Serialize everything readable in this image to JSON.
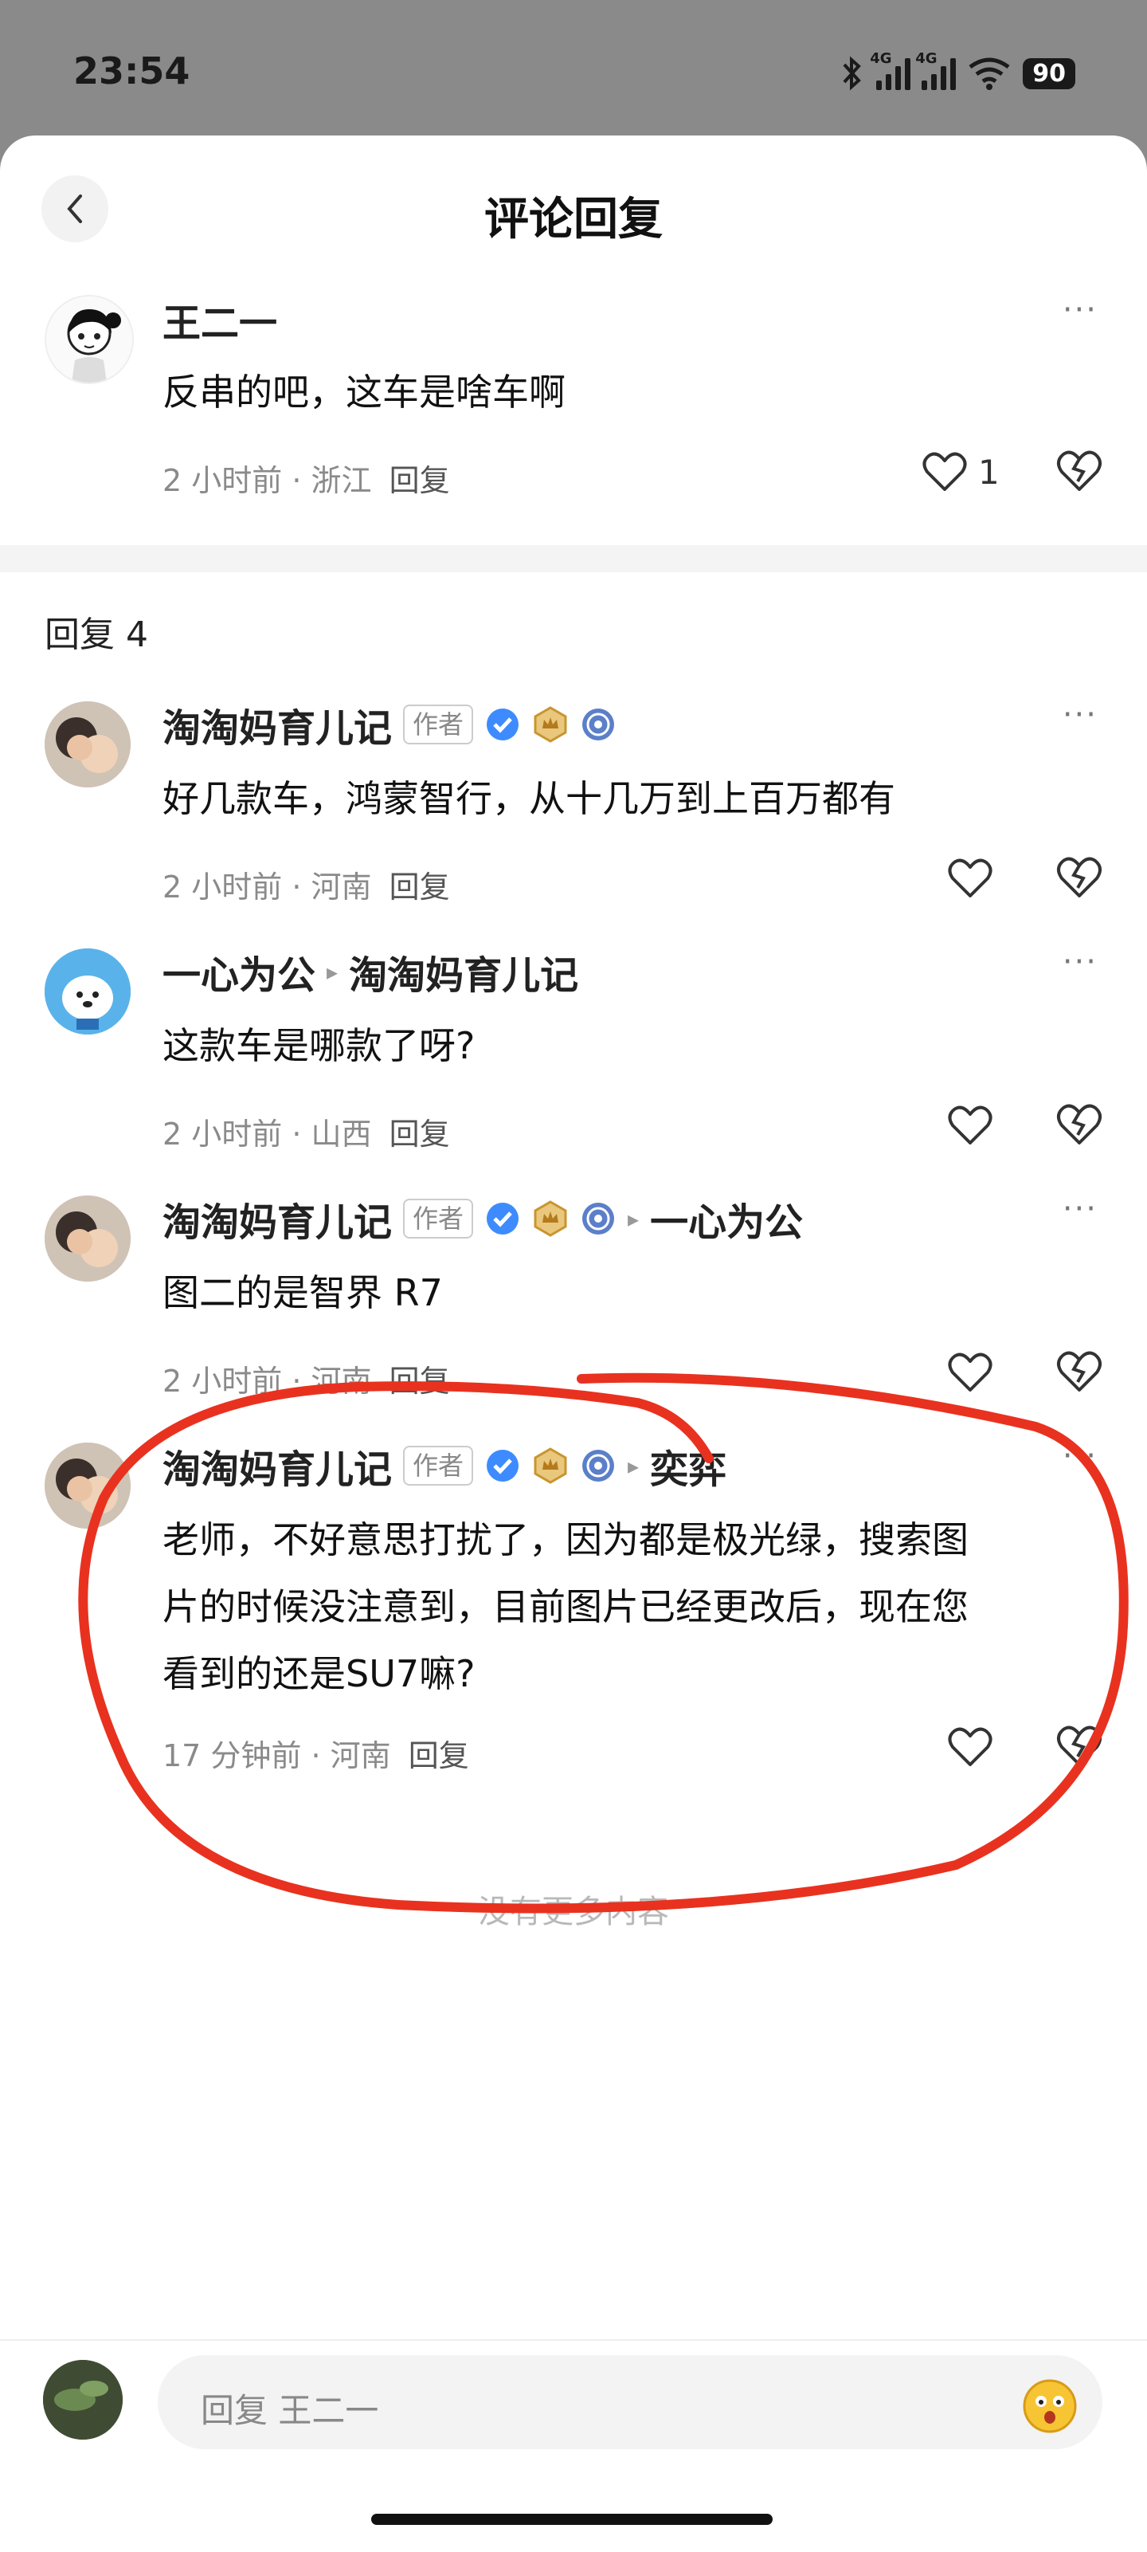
{
  "status": {
    "time": "23:54",
    "net1": "4G",
    "net2": "4G",
    "battery": "90"
  },
  "header": {
    "title": "评论回复"
  },
  "main_comment": {
    "name": "王二一",
    "text": "反串的吧，这车是啥车啊",
    "meta": "2 小时前 · 浙江",
    "reply_label": "回复",
    "likes": "1"
  },
  "reply_count": "回复 4",
  "replies": [
    {
      "name": "淘淘妈育儿记",
      "author_tag": "作者",
      "text": "好几款车，鸿蒙智行，从十几万到上百万都有",
      "meta": "2 小时前 · 河南",
      "reply_label": "回复"
    },
    {
      "name": "一心为公",
      "target": "淘淘妈育儿记",
      "text": "这款车是哪款了呀?",
      "meta": "2 小时前 · 山西",
      "reply_label": "回复"
    },
    {
      "name": "淘淘妈育儿记",
      "author_tag": "作者",
      "target": "一心为公",
      "text": "图二的是智界 R7",
      "meta": "2 小时前 · 河南",
      "reply_label": "回复"
    },
    {
      "name": "淘淘妈育儿记",
      "author_tag": "作者",
      "target": "奕弈",
      "text_lines": [
        "老师，不好意思打扰了，因为都是极光绿，搜索图",
        "片的时候没注意到，目前图片已经更改后，现在您",
        "看到的还是SU7嘛?"
      ],
      "meta": "17 分钟前 · 河南",
      "reply_label": "回复"
    }
  ],
  "no_more": "没有更多内容",
  "reply_bar": {
    "placeholder": "回复 王二一"
  },
  "colors": {
    "verified": "#3d8bff",
    "crown_badge": "#d9a441",
    "annotation": "#e8321f"
  }
}
